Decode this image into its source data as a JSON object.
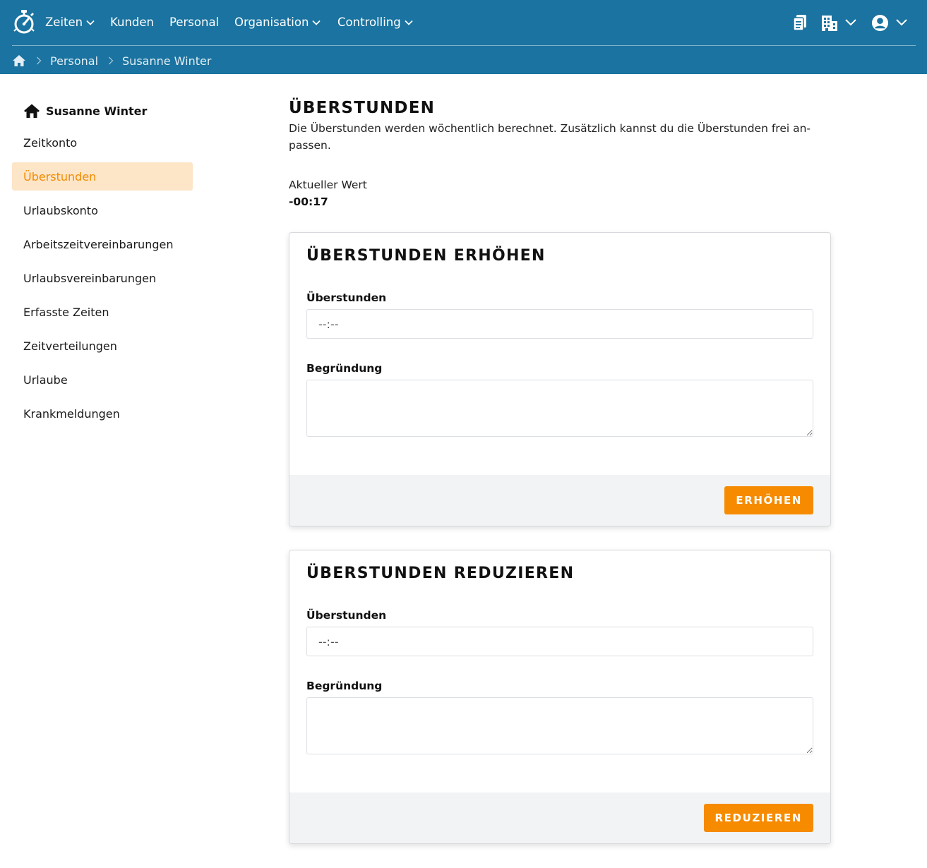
{
  "colors": {
    "nav_bg": "#1a73a0",
    "accent": "#f68b00",
    "active_bg": "#fde5c8"
  },
  "nav": {
    "logo_icon": "stopwatch-logo-icon",
    "items": [
      {
        "label": "Zeiten",
        "has_dropdown": true
      },
      {
        "label": "Kunden",
        "has_dropdown": false
      },
      {
        "label": "Personal",
        "has_dropdown": false
      },
      {
        "label": "Organisation",
        "has_dropdown": true
      },
      {
        "label": "Controlling",
        "has_dropdown": true
      }
    ],
    "right_icons": [
      "clipboard-icon",
      "building-icon",
      "user-account-icon"
    ]
  },
  "breadcrumb": {
    "home_icon": "home-icon",
    "items": [
      "Personal",
      "Susanne Winter"
    ]
  },
  "sidebar": {
    "title": "Susanne Winter",
    "items": [
      {
        "label": "Zeitkonto",
        "active": false
      },
      {
        "label": "Überstunden",
        "active": true
      },
      {
        "label": "Urlaubskonto",
        "active": false
      },
      {
        "label": "Arbeitszeitvereinbarungen",
        "active": false
      },
      {
        "label": "Urlaubsvereinbarungen",
        "active": false
      },
      {
        "label": "Erfasste Zeiten",
        "active": false
      },
      {
        "label": "Zeitverteilungen",
        "active": false
      },
      {
        "label": "Urlaube",
        "active": false
      },
      {
        "label": "Krankmeldungen",
        "active": false
      }
    ]
  },
  "main": {
    "title": "ÜBERSTUNDEN",
    "description": "Die Überstunden werden wöchentlich berechnet. Zusätzlich kannst du die Überstunden frei an-passen.",
    "current_label": "Aktueller Wert",
    "current_value": "-00:17"
  },
  "increase_card": {
    "title": "ÜBERSTUNDEN ERHÖHEN",
    "hours_label": "Überstunden",
    "hours_placeholder": "--:--",
    "reason_label": "Begründung",
    "reason_value": "",
    "button_label": "ERHÖHEN"
  },
  "decrease_card": {
    "title": "ÜBERSTUNDEN REDUZIEREN",
    "hours_label": "Überstunden",
    "hours_placeholder": "--:--",
    "reason_label": "Begründung",
    "reason_value": "",
    "button_label": "REDUZIEREN"
  }
}
